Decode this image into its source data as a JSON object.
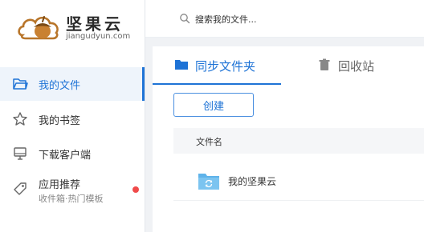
{
  "brand": {
    "name": "坚果云",
    "domain": "jiangudyun.com"
  },
  "search": {
    "placeholder": "搜索我的文件..."
  },
  "sidebar": {
    "items": [
      {
        "label": "我的文件",
        "icon": "folder-outline-icon",
        "active": true
      },
      {
        "label": "我的书签",
        "icon": "star-outline-icon",
        "active": false
      },
      {
        "label": "下载客户端",
        "icon": "monitor-icon",
        "active": false
      },
      {
        "label": "应用推荐",
        "sub": "收件箱·热门模板",
        "icon": "tag-icon",
        "active": false,
        "badge": "red-dot"
      }
    ]
  },
  "tabs": [
    {
      "label": "同步文件夹",
      "icon": "folder-icon",
      "active": true
    },
    {
      "label": "回收站",
      "icon": "trash-icon",
      "active": false
    }
  ],
  "toolbar": {
    "create_label": "创建"
  },
  "file_table": {
    "columns": [
      "文件名"
    ],
    "rows": [
      {
        "name": "我的坚果云",
        "icon": "sync-folder-icon"
      }
    ]
  },
  "colors": {
    "accent": "#1e73d6",
    "badge": "#f04a4a",
    "folder": "#5fb3ea"
  }
}
